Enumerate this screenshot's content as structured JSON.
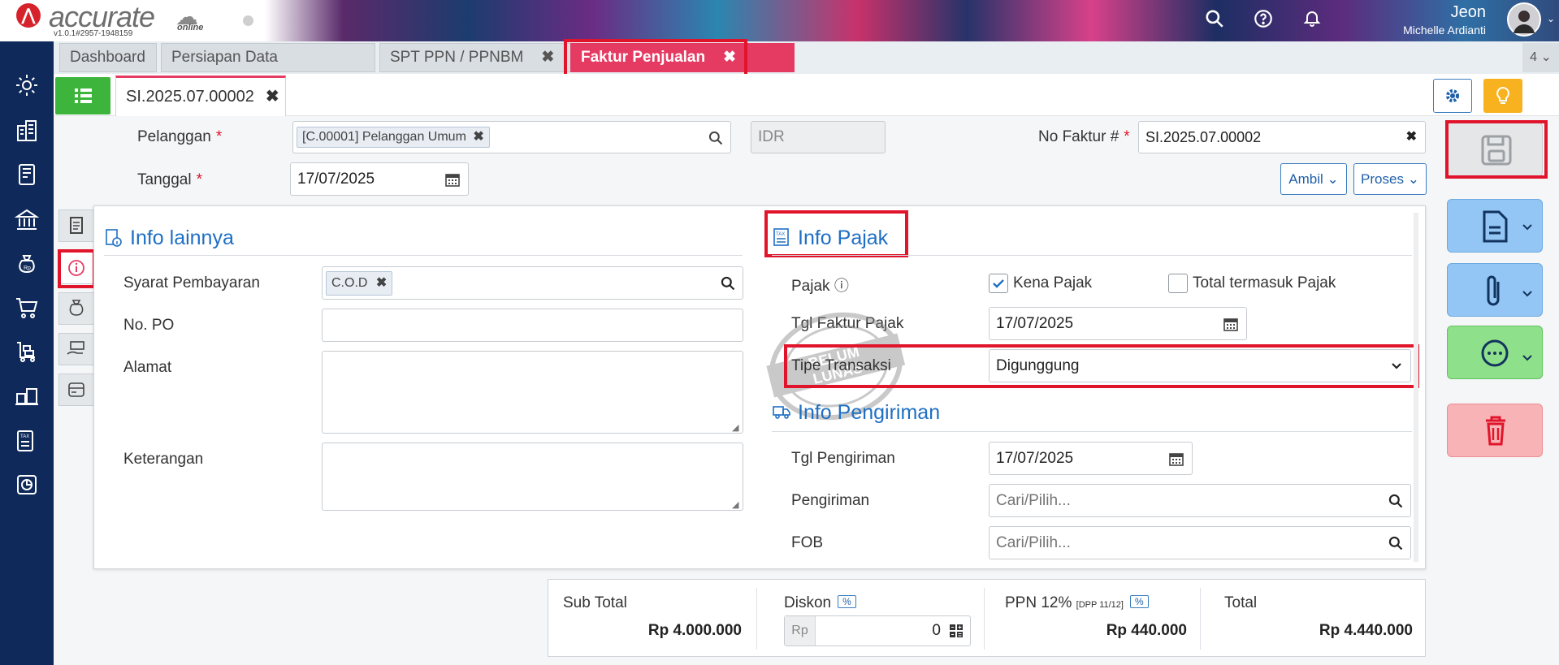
{
  "app": {
    "brand": "accurate",
    "brand_sub": "online",
    "version": "v1.0.1#2957-1948159"
  },
  "user": {
    "name": "Jeon",
    "full_name": "Michelle Ardianti"
  },
  "tabs": [
    {
      "label": "Dashboard"
    },
    {
      "label": "Persiapan Data Perusahaan"
    },
    {
      "label": "SPT PPN / PPNBM",
      "close": "✖"
    },
    {
      "label": "Faktur Penjualan",
      "close": "✖"
    }
  ],
  "tab_count": "4",
  "doc_tab": {
    "label": "SI.2025.07.00002",
    "close": "✖"
  },
  "header_form": {
    "pelanggan_label": "Pelanggan",
    "pelanggan_value": "[C.00001] Pelanggan Umum",
    "currency": "IDR",
    "no_faktur_label": "No Faktur #",
    "no_faktur_value": "SI.2025.07.00002",
    "tanggal_label": "Tanggal",
    "tanggal_value": "17/07/2025",
    "ambil_label": "Ambil",
    "proses_label": "Proses",
    "required_mark": "*"
  },
  "info_lainnya": {
    "title": "Info lainnya",
    "syarat_label": "Syarat Pembayaran",
    "syarat_value": "C.O.D",
    "po_label": "No. PO",
    "po_value": "",
    "alamat_label": "Alamat",
    "alamat_value": "",
    "keterangan_label": "Keterangan",
    "keterangan_value": ""
  },
  "info_pajak": {
    "title": "Info Pajak",
    "pajak_label": "Pajak",
    "kena_pajak_label": "Kena Pajak",
    "kena_pajak_checked": true,
    "total_termasuk_label": "Total termasuk Pajak",
    "total_termasuk_checked": false,
    "tgl_faktur_label": "Tgl Faktur Pajak",
    "tgl_faktur_value": "17/07/2025",
    "tipe_label": "Tipe Transaksi",
    "tipe_value": "Digunggung"
  },
  "info_pengiriman": {
    "title": "Info Pengiriman",
    "tgl_label": "Tgl Pengiriman",
    "tgl_value": "17/07/2025",
    "pengiriman_label": "Pengiriman",
    "pengiriman_placeholder": "Cari/Pilih...",
    "fob_label": "FOB",
    "fob_placeholder": "Cari/Pilih..."
  },
  "stamp": {
    "line1": "BELUM",
    "line2": "LUNAS"
  },
  "totals": {
    "subtotal_label": "Sub Total",
    "subtotal_value": "Rp 4.000.000",
    "diskon_label": "Diskon",
    "pct": "%",
    "diskon_prefix": "Rp",
    "diskon_value": "0",
    "ppn_label": "PPN 12%",
    "ppn_sub": "[DPP 11/12]",
    "ppn_value": "Rp 440.000",
    "total_label": "Total",
    "total_value": "Rp 4.440.000"
  },
  "colors": {
    "accent_tab": "#e53a62",
    "highlight_box": "#e0142b",
    "link_blue": "#1e6fc4",
    "sidebar": "#0f2a5a"
  }
}
